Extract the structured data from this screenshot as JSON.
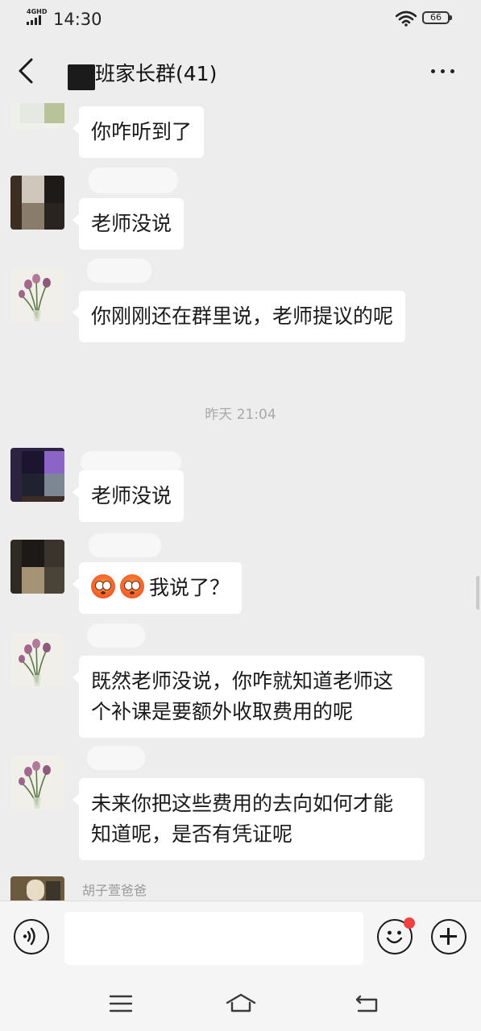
{
  "status_bar": {
    "network": "4GHD",
    "time": "14:30",
    "battery": "66"
  },
  "header": {
    "title": "班家长群(41)"
  },
  "messages": [
    {
      "text": "你咋听到了"
    },
    {
      "text": "老师没说"
    },
    {
      "text": "你刚刚还在群里说，老师提议的呢"
    },
    {
      "text": "老师没说"
    },
    {
      "text": "我说了？"
    },
    {
      "text": "既然老师没说，你咋就知道老师这个补课是要额外收取费用的呢"
    },
    {
      "text": "未来你把这些费用的去向如何才能知道呢，是否有凭证呢"
    }
  ],
  "timestamp": "昨天 21:04",
  "last_sender": "胡子萱爸爸",
  "emoji": [
    "flushed-face",
    "flushed-face"
  ],
  "colors": {
    "background": "#ededed",
    "bubble": "#ffffff",
    "notification_dot": "#f2413e"
  },
  "icons": {
    "back": "chevron-left-icon",
    "more": "more-dots-icon",
    "voice": "voice-icon",
    "emoji": "smile-icon",
    "add": "plus-icon"
  }
}
